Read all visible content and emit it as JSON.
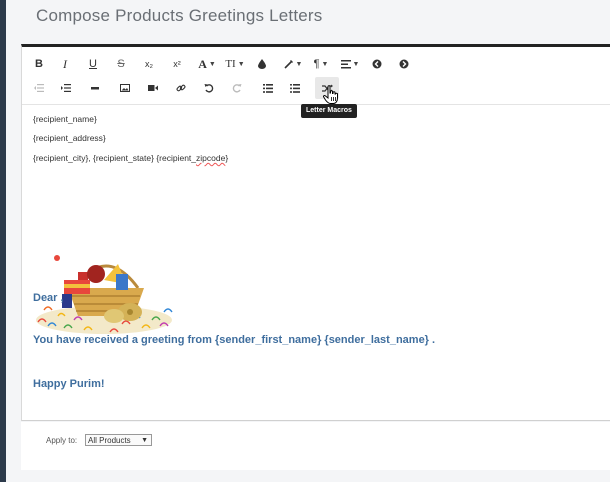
{
  "page": {
    "title": "Compose Products Greetings Letters"
  },
  "toolbar": {
    "row1": [
      {
        "name": "bold-button",
        "label": "B",
        "style": "bold"
      },
      {
        "name": "italic-button",
        "label": "I",
        "style": "italic"
      },
      {
        "name": "underline-button",
        "label": "U",
        "style": "underline"
      },
      {
        "name": "strikethrough-button",
        "label": "S",
        "style": "strike"
      },
      {
        "name": "subscript-button",
        "label": "x₂"
      },
      {
        "name": "superscript-button",
        "label": "x²"
      },
      {
        "name": "font-family-button",
        "label": "A"
      },
      {
        "name": "font-size-button",
        "label": "TI"
      }
    ],
    "tooltip": "Letter Macros"
  },
  "letter": {
    "recipient_name": "{recipient_name}",
    "recipient_address": "{recipient_address}",
    "recipient_city_line_pre": "{recipient_city}, {recipient_state}  {recipient_",
    "recipient_city_line_underlined": "zipcode",
    "recipient_city_line_post": "}",
    "salutation": "Dear ,",
    "body_line": "You have received a greeting from {sender_first_name}  {sender_last_name} .",
    "closing": "Happy Purim!"
  },
  "footer": {
    "apply_label": "Apply to:",
    "apply_value": "All Products",
    "apply_arrow": "▼"
  },
  "colors": {
    "accent": "#3f6e9e",
    "toolbar_border": "#222222"
  }
}
